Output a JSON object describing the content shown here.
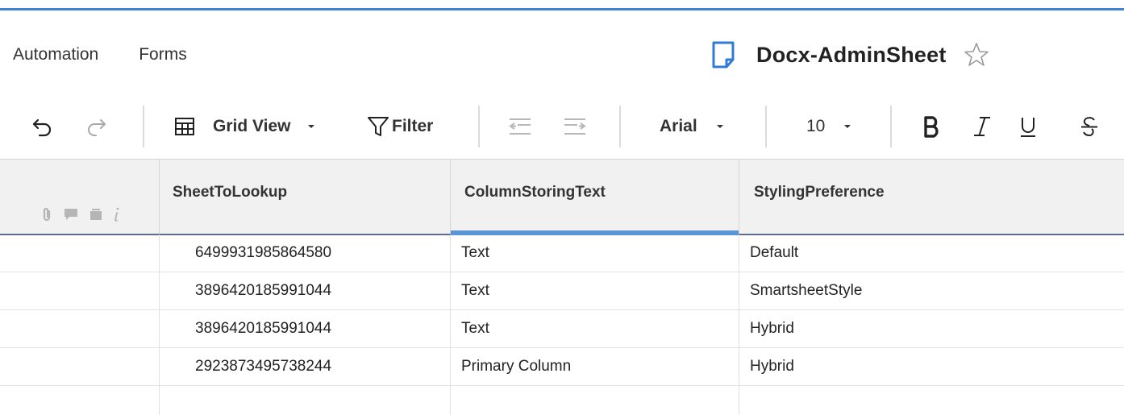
{
  "menu": {
    "items": [
      "Automation",
      "Forms"
    ]
  },
  "document": {
    "title": "Docx-AdminSheet"
  },
  "toolbar": {
    "view_label": "Grid View",
    "filter_label": "Filter",
    "font_name": "Arial",
    "font_size": "10"
  },
  "header": {
    "columns": [
      "SheetToLookup",
      "ColumnStoringText",
      "StylingPreference"
    ]
  },
  "rows": [
    {
      "sheet": "6499931985864580",
      "column": "Text",
      "style": "Default"
    },
    {
      "sheet": "3896420185991044",
      "column": "Text",
      "style": "SmartsheetStyle"
    },
    {
      "sheet": "3896420185991044",
      "column": "Text",
      "style": "Hybrid"
    },
    {
      "sheet": "2923873495738244",
      "column": "Primary Column",
      "style": "Hybrid"
    },
    {
      "sheet": "",
      "column": "",
      "style": ""
    }
  ],
  "colors": {
    "accent": "#3f84d8",
    "selected_column": "#5b95d6",
    "header_line": "#5d6e8c"
  }
}
